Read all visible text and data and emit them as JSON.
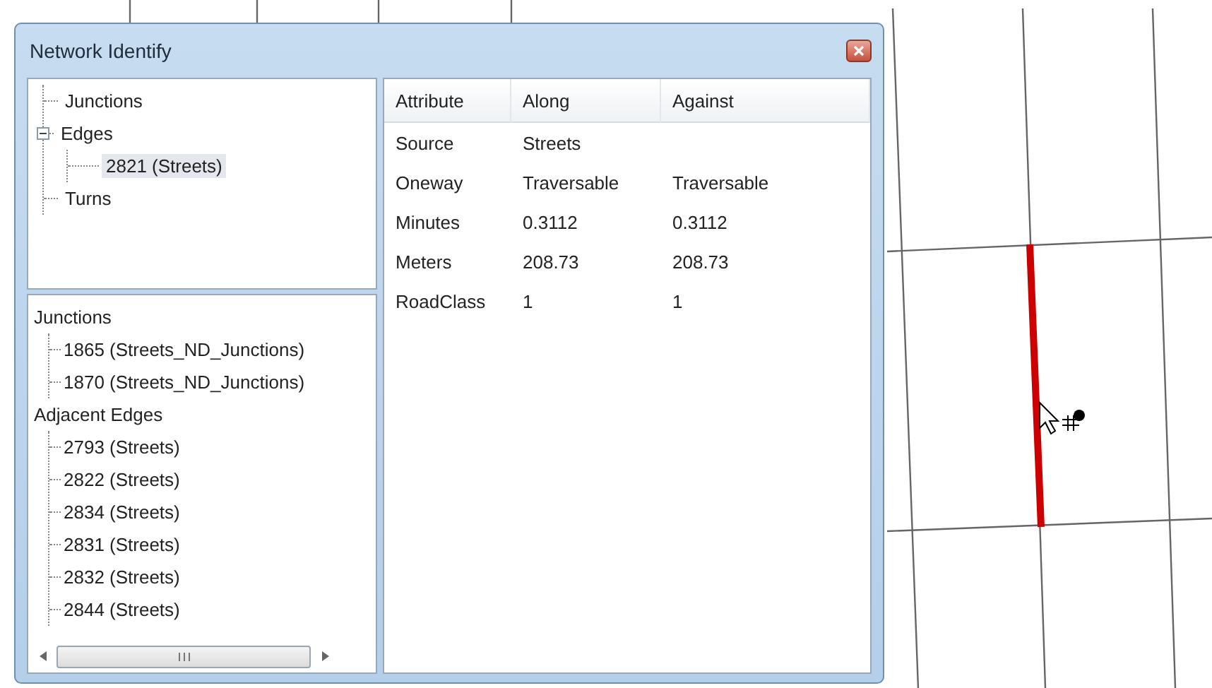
{
  "window": {
    "title": "Network Identify"
  },
  "tree": [
    {
      "label": "Junctions",
      "selected": false
    },
    {
      "label": "Edges",
      "expanded": true,
      "selected": false,
      "children": [
        {
          "label": "2821 (Streets)",
          "selected": true
        }
      ]
    },
    {
      "label": "Turns",
      "selected": false
    }
  ],
  "details": [
    {
      "label": "Junctions",
      "children": [
        "1865 (Streets_ND_Junctions)",
        "1870 (Streets_ND_Junctions)"
      ]
    },
    {
      "label": "Adjacent Edges",
      "children": [
        "2793 (Streets)",
        "2822 (Streets)",
        "2834 (Streets)",
        "2831 (Streets)",
        "2832 (Streets)",
        "2844 (Streets)"
      ]
    }
  ],
  "table": {
    "columns": [
      "Attribute",
      "Along",
      "Against"
    ],
    "rows": [
      [
        "Source",
        "Streets",
        ""
      ],
      [
        "Oneway",
        "Traversable",
        "Traversable"
      ],
      [
        "Minutes",
        "0.3112",
        "0.3112"
      ],
      [
        "Meters",
        "208.73",
        "208.73"
      ],
      [
        "RoadClass",
        "1",
        "1"
      ]
    ]
  }
}
